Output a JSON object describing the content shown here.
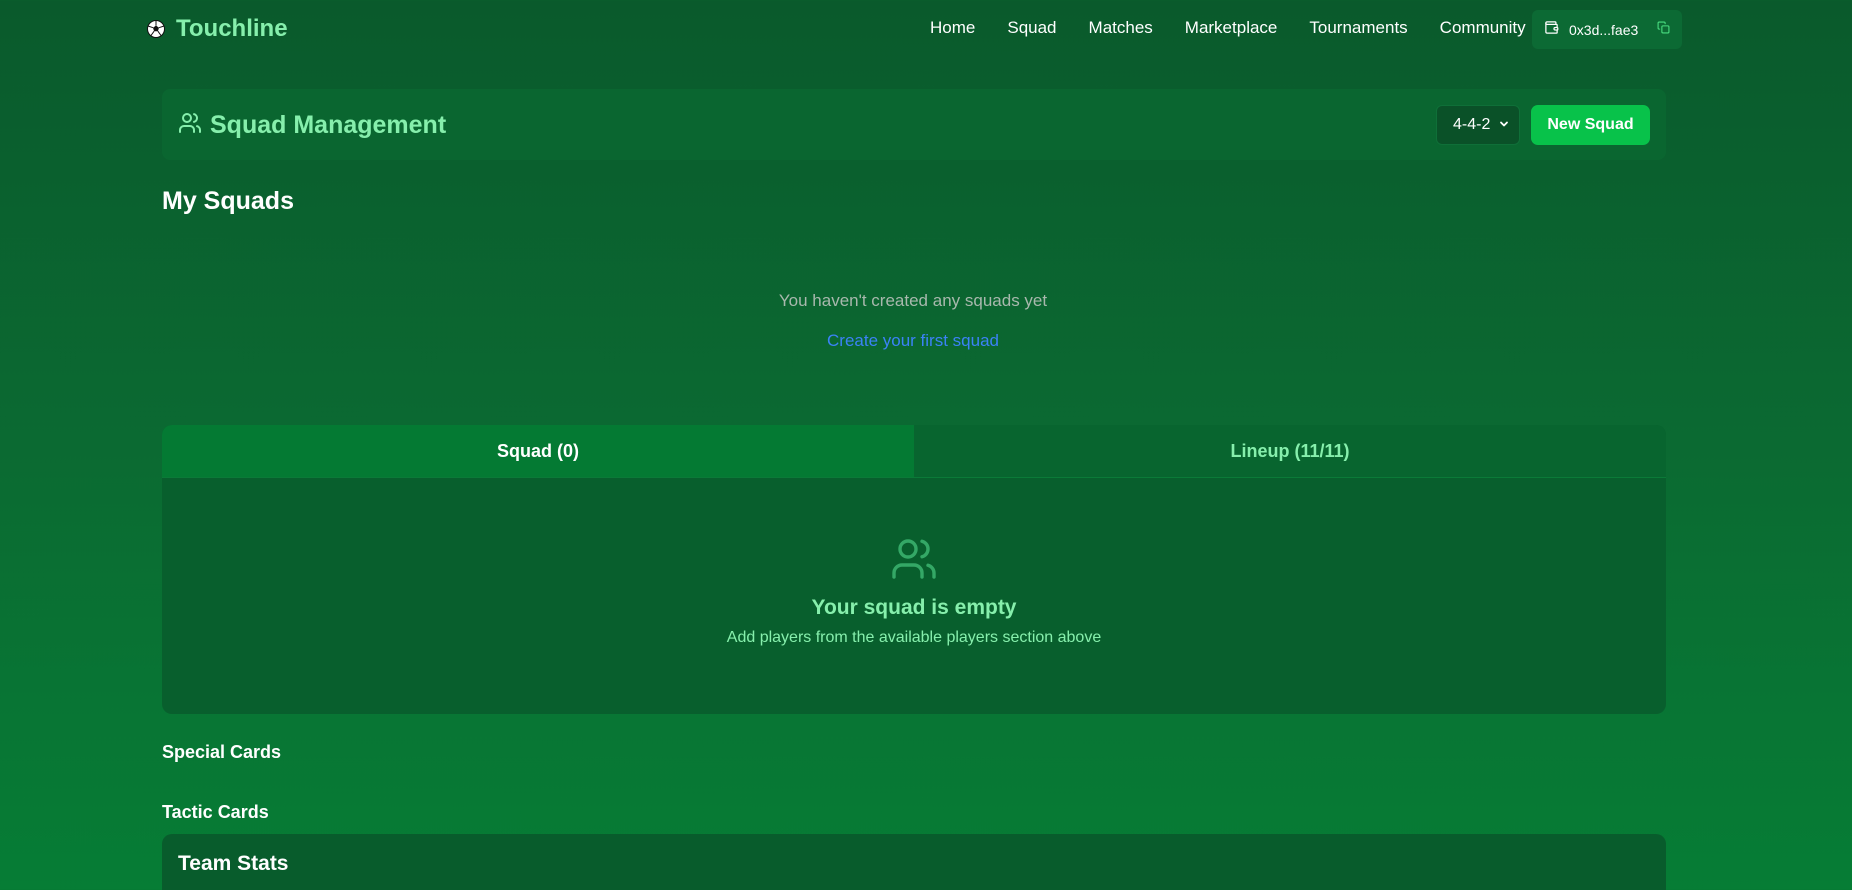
{
  "nav": {
    "brand": "Touchline",
    "links": [
      "Home",
      "Squad",
      "Matches",
      "Marketplace",
      "Tournaments",
      "Community"
    ],
    "wallet_address": "0x3d...fae3"
  },
  "header": {
    "title": "Squad Management",
    "formation_value": "4-4-2",
    "new_squad_label": "New Squad"
  },
  "my_squads": {
    "title": "My Squads",
    "empty_text": "You haven't created any squads yet",
    "create_link": "Create your first squad"
  },
  "tabs": {
    "items": [
      {
        "label": "Squad (0)",
        "active": true
      },
      {
        "label": "Lineup (11/11)",
        "active": false
      }
    ],
    "empty_title": "Your squad is empty",
    "empty_subtitle": "Add players from the available players section above"
  },
  "sections": {
    "special_cards": "Special Cards",
    "tactic_cards": "Tactic Cards",
    "team_stats": "Team Stats"
  },
  "colors": {
    "accent_green": "#86efac",
    "button_green": "#08c24a",
    "link_blue": "#3b82f6"
  },
  "icons": {
    "brand": "soccer-ball-icon",
    "wallet": "wallet-icon",
    "copy": "copy-icon",
    "header": "users-icon",
    "empty": "users-icon",
    "select": "chevron-down-icon"
  }
}
